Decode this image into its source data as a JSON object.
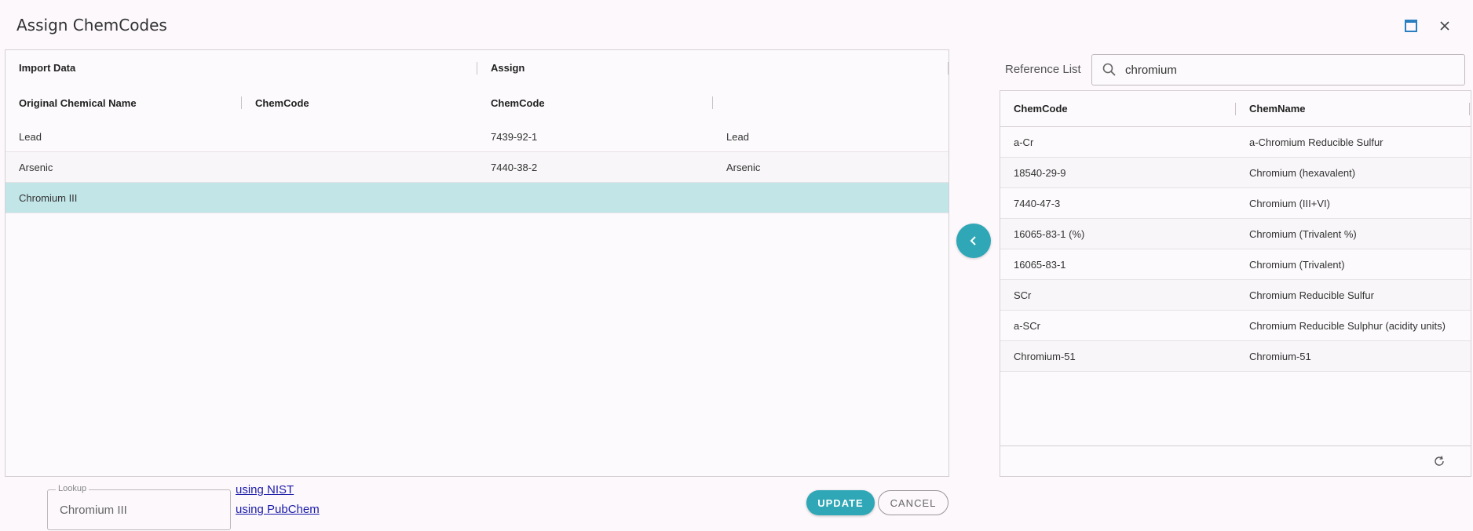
{
  "dialog": {
    "title": "Assign ChemCodes"
  },
  "left_grid": {
    "group_headers": [
      "Import Data",
      "Assign"
    ],
    "columns": [
      "Original Chemical Name",
      "ChemCode",
      "ChemCode",
      ""
    ],
    "rows": [
      [
        "Lead",
        "",
        "7439-92-1",
        "Lead"
      ],
      [
        "Arsenic",
        "",
        "7440-38-2",
        "Arsenic"
      ],
      [
        "Chromium III",
        "",
        "",
        ""
      ]
    ],
    "selected_row": 2
  },
  "reference": {
    "label": "Reference List",
    "search_value": "chromium",
    "columns": [
      "ChemCode",
      "ChemName"
    ],
    "rows": [
      [
        "a-Cr",
        "a-Chromium Reducible Sulfur"
      ],
      [
        "18540-29-9",
        "Chromium (hexavalent)"
      ],
      [
        "7440-47-3",
        "Chromium (III+VI)"
      ],
      [
        "16065-83-1 (%)",
        "Chromium (Trivalent %)"
      ],
      [
        "16065-83-1",
        "Chromium (Trivalent)"
      ],
      [
        "SCr",
        "Chromium Reducible Sulfur"
      ],
      [
        "a-SCr",
        "Chromium Reducible Sulphur (acidity units)"
      ],
      [
        "Chromium-51",
        "Chromium-51"
      ]
    ]
  },
  "lookup": {
    "label": "Lookup",
    "value": "Chromium III",
    "links": [
      "using NIST",
      "using PubChem"
    ]
  },
  "actions": {
    "update": "UPDATE",
    "cancel": "CANCEL"
  },
  "colors": {
    "accent": "#2fa7b6",
    "selected_row": "#c2e5e8"
  },
  "icons": [
    "maximize-icon",
    "close-icon",
    "chevron-left-icon",
    "search-icon",
    "refresh-icon"
  ]
}
